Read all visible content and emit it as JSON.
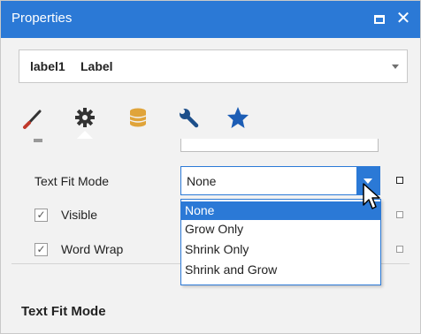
{
  "window": {
    "title": "Properties",
    "maximize_icon": "maximize-icon",
    "close_icon": "close-icon",
    "close_glyph": "✕"
  },
  "object_selector": {
    "name": "label1",
    "type": "Label"
  },
  "tabs": [
    {
      "icon": "brush-icon",
      "color": "#c0392b"
    },
    {
      "icon": "gear-icon",
      "color": "#333333",
      "active": true
    },
    {
      "icon": "database-icon",
      "color": "#e0a43a"
    },
    {
      "icon": "wrench-icon",
      "color": "#1d4f8a"
    },
    {
      "icon": "star-icon",
      "color": "#1c5db5"
    }
  ],
  "properties": {
    "text_fit_mode": {
      "label": "Text Fit Mode",
      "value": "None"
    },
    "visible": {
      "label": "Visible",
      "checked": true,
      "check_glyph": "✓"
    },
    "word_wrap": {
      "label": "Word Wrap",
      "checked": true,
      "check_glyph": "✓"
    }
  },
  "dropdown": {
    "options": [
      "None",
      "Grow Only",
      "Shrink Only",
      "Shrink and Grow"
    ],
    "selected": "None"
  },
  "description": {
    "title": "Text Fit Mode"
  },
  "colors": {
    "accent": "#2b79d6",
    "panel_bg": "#f2f2f2"
  }
}
